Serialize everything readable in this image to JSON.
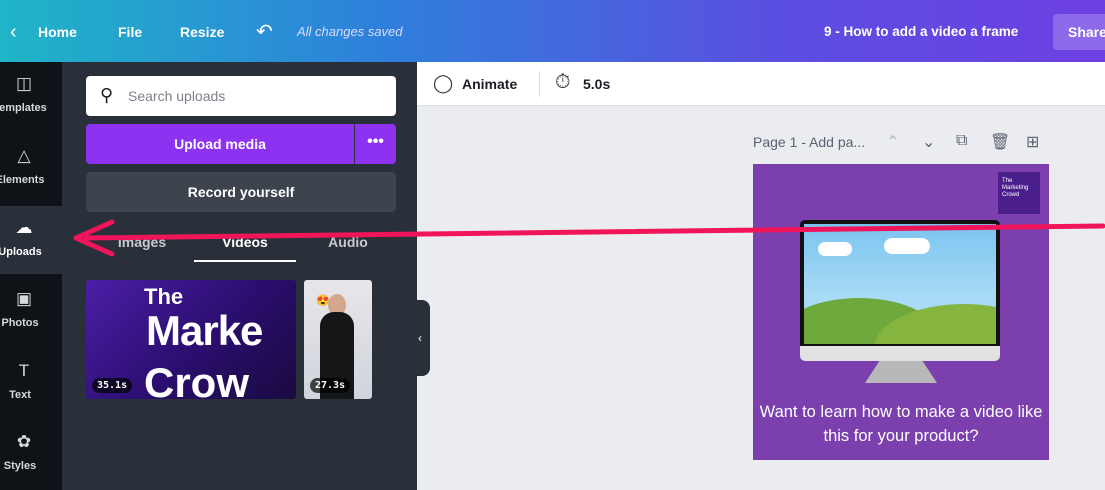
{
  "topbar": {
    "back_icon": "chevron-left-icon",
    "home": "Home",
    "file": "File",
    "resize": "Resize",
    "undo_icon": "undo-icon",
    "saved_status": "All changes saved",
    "doc_title": "9 - How to add a video a frame",
    "share": "Share"
  },
  "rail": {
    "items": [
      {
        "label": "Templates",
        "icon": "templates-icon"
      },
      {
        "label": "Elements",
        "icon": "elements-icon"
      },
      {
        "label": "Uploads",
        "icon": "upload-cloud-icon"
      },
      {
        "label": "Photos",
        "icon": "photos-icon"
      },
      {
        "label": "Text",
        "icon": "text-icon"
      },
      {
        "label": "Styles",
        "icon": "palette-icon"
      }
    ]
  },
  "panel": {
    "search_placeholder": "Search uploads",
    "upload_button": "Upload media",
    "more_button": "•••",
    "record_button": "Record yourself",
    "tabs": [
      "Images",
      "Videos",
      "Audio"
    ],
    "videos": [
      {
        "duration": "35.1s",
        "thumb_text": [
          "The",
          "Marke",
          "Crow"
        ]
      },
      {
        "duration": "27.3s"
      }
    ]
  },
  "editor": {
    "animate": "Animate",
    "duration": "5.0s",
    "page_title": "Page 1 - Add pa...",
    "canvas_logo": "The Marketing Crowd",
    "caption": "Want to learn how to make a video like this for your product?"
  },
  "colors": {
    "brand_purple": "#8c32f0",
    "canvas_purple": "#7b3fae",
    "arrow": "#f0145a"
  }
}
